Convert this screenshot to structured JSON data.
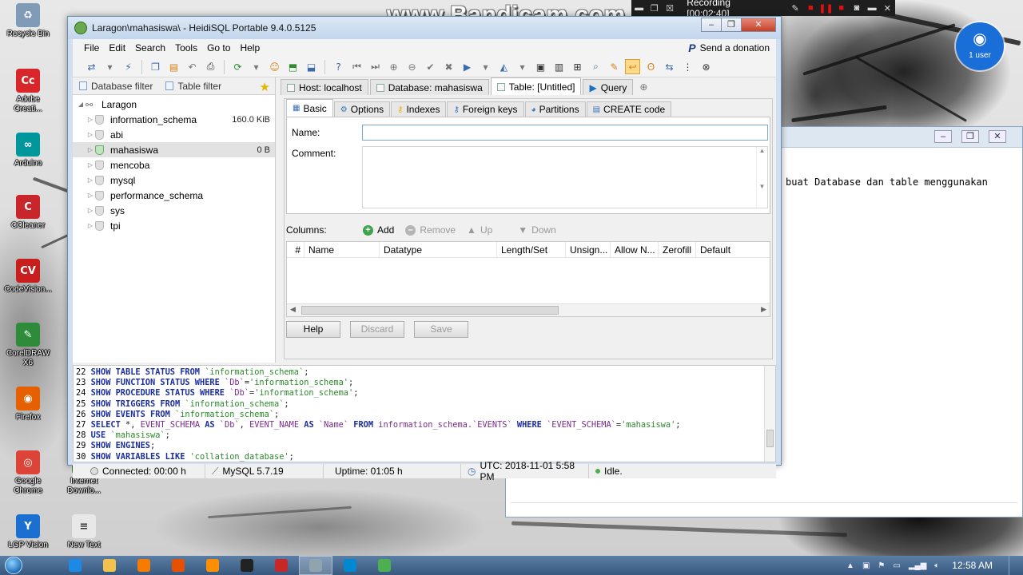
{
  "overlay": {
    "watermark": "www.Bandicam.com",
    "recording": "Recording [00:02:40]",
    "users": "1 user"
  },
  "desktop_icons": [
    {
      "label": "Recycle Bin",
      "color": "#7f9bb8",
      "glyph": "♻"
    },
    {
      "label": "Adobe Creati...",
      "color": "#d8262b",
      "glyph": "Cc"
    },
    {
      "label": "Arduino",
      "color": "#00979c",
      "glyph": "∞"
    },
    {
      "label": "CCleaner",
      "color": "#c8262b",
      "glyph": "C"
    },
    {
      "label": "CodeVision...",
      "color": "#c81e1e",
      "glyph": "CV"
    },
    {
      "label": "CorelDRAW X6",
      "color": "#2e8b3a",
      "glyph": "✎"
    },
    {
      "label": "Firefox",
      "color": "#e66000",
      "glyph": "◉"
    },
    {
      "label": "Google Chrome",
      "color": "#db4437",
      "glyph": "◎"
    },
    {
      "label": "LGP Vision",
      "color": "#1a6fd1",
      "glyph": "Y"
    }
  ],
  "desktop_icons_col2": [
    {
      "label": "Internet Downlo...",
      "color": "#3b7d3b",
      "glyph": "⇩"
    },
    {
      "label": "New Text",
      "color": "#e8e8e8",
      "glyph": "≡"
    }
  ],
  "background_window": {
    "text": "buat Database dan table menggunakan"
  },
  "heidi": {
    "title": "Laragon\\mahasiswa\\ - HeidiSQL Portable 9.4.0.5125",
    "menu": [
      "File",
      "Edit",
      "Search",
      "Tools",
      "Go to",
      "Help"
    ],
    "donate": "Send a donation",
    "filters": {
      "database": "Database filter",
      "table": "Table filter"
    },
    "tree": {
      "root": "Laragon",
      "databases": [
        {
          "name": "information_schema",
          "size": "160.0 KiB"
        },
        {
          "name": "abi",
          "size": ""
        },
        {
          "name": "mahasiswa",
          "size": "0 B"
        },
        {
          "name": "mencoba",
          "size": ""
        },
        {
          "name": "mysql",
          "size": ""
        },
        {
          "name": "performance_schema",
          "size": ""
        },
        {
          "name": "sys",
          "size": ""
        },
        {
          "name": "tpi",
          "size": ""
        }
      ]
    },
    "main_tabs": [
      "Host: localhost",
      "Database: mahasiswa",
      "Table: [Untitled]",
      "Query"
    ],
    "sub_tabs": [
      "Basic",
      "Options",
      "Indexes",
      "Foreign keys",
      "Partitions",
      "CREATE code"
    ],
    "name_label": "Name:",
    "comment_label": "Comment:",
    "name_value": "",
    "columns_label": "Columns:",
    "column_actions": [
      "Add",
      "Remove",
      "Up",
      "Down"
    ],
    "column_headers": [
      "#",
      "Name",
      "Datatype",
      "Length/Set",
      "Unsign...",
      "Allow N...",
      "Zerofill",
      "Default"
    ],
    "buttons": [
      "Help",
      "Discard",
      "Save"
    ],
    "log": [
      {
        "n": "22",
        "parts": [
          [
            "kw",
            "SHOW TABLE STATUS FROM "
          ],
          [
            "str",
            "`information_schema`"
          ],
          [
            "num",
            ";"
          ]
        ]
      },
      {
        "n": "23",
        "parts": [
          [
            "kw",
            "SHOW FUNCTION STATUS WHERE "
          ],
          [
            "ident",
            "`Db`"
          ],
          [
            "num",
            "="
          ],
          [
            "str",
            "'information_schema'"
          ],
          [
            "num",
            ";"
          ]
        ]
      },
      {
        "n": "24",
        "parts": [
          [
            "kw",
            "SHOW PROCEDURE STATUS WHERE "
          ],
          [
            "ident",
            "`Db`"
          ],
          [
            "num",
            "="
          ],
          [
            "str",
            "'information_schema'"
          ],
          [
            "num",
            ";"
          ]
        ]
      },
      {
        "n": "25",
        "parts": [
          [
            "kw",
            "SHOW TRIGGERS FROM "
          ],
          [
            "str",
            "`information_schema`"
          ],
          [
            "num",
            ";"
          ]
        ]
      },
      {
        "n": "26",
        "parts": [
          [
            "kw",
            "SHOW EVENTS FROM "
          ],
          [
            "str",
            "`information_schema`"
          ],
          [
            "num",
            ";"
          ]
        ]
      },
      {
        "n": "27",
        "parts": [
          [
            "kw",
            "SELECT "
          ],
          [
            "num",
            "*, "
          ],
          [
            "ident",
            "EVENT_SCHEMA"
          ],
          [
            "kw",
            " AS "
          ],
          [
            "ident",
            "`Db`"
          ],
          [
            "num",
            ", "
          ],
          [
            "ident",
            "EVENT_NAME"
          ],
          [
            "kw",
            " AS "
          ],
          [
            "ident",
            "`Name`"
          ],
          [
            "kw",
            " FROM "
          ],
          [
            "ident",
            "information_schema.`EVENTS`"
          ],
          [
            "kw",
            " WHERE "
          ],
          [
            "ident",
            "`EVENT_SCHEMA`"
          ],
          [
            "num",
            "="
          ],
          [
            "str",
            "'mahasiswa'"
          ],
          [
            "num",
            ";"
          ]
        ]
      },
      {
        "n": "28",
        "parts": [
          [
            "kw",
            "USE "
          ],
          [
            "str",
            "`mahasiswa`"
          ],
          [
            "num",
            ";"
          ]
        ]
      },
      {
        "n": "29",
        "parts": [
          [
            "kw",
            "SHOW ENGINES"
          ],
          [
            "num",
            ";"
          ]
        ]
      },
      {
        "n": "30",
        "parts": [
          [
            "kw",
            "SHOW VARIABLES LIKE "
          ],
          [
            "str",
            "'collation_database'"
          ],
          [
            "num",
            ";"
          ]
        ]
      }
    ],
    "status": {
      "connected": "Connected: 00:00 h",
      "server": "MySQL 5.7.19",
      "uptime": "Uptime: 01:05 h",
      "utc": "UTC: 2018-11-01 5:58 PM",
      "state": "Idle."
    }
  },
  "taskbar": {
    "clock": "12:58 AM",
    "apps": [
      {
        "name": "internet-explorer",
        "color": "#1e88e5"
      },
      {
        "name": "file-explorer",
        "color": "#f2c14e"
      },
      {
        "name": "media-player",
        "color": "#f57c00"
      },
      {
        "name": "firefox",
        "color": "#e65100"
      },
      {
        "name": "sublime-text",
        "color": "#ff8f00"
      },
      {
        "name": "github",
        "color": "#222222"
      },
      {
        "name": "bandicam",
        "color": "#c62828"
      },
      {
        "name": "notepad",
        "color": "#90a4ae"
      },
      {
        "name": "laragon",
        "color": "#0288d1"
      },
      {
        "name": "heidisql",
        "color": "#4caf50"
      }
    ]
  }
}
